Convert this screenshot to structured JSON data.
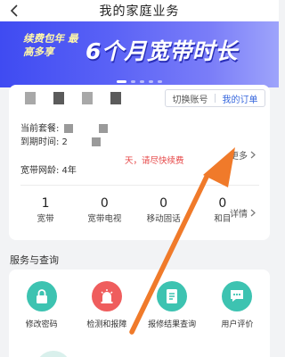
{
  "nav": {
    "back_icon": "chevron-left-icon",
    "title": "我的家庭业务"
  },
  "banner": {
    "slogan": "续费包年 最高多享",
    "headline": "6个月宽带时长"
  },
  "account": {
    "switch_account": "切换账号",
    "my_orders": "我的订单",
    "package_label": "当前套餐:",
    "expiry_label": "到期时间: 2",
    "expiry_warning": "天，请尽快续费",
    "broadband_age": "宽带网龄: 4年",
    "more": "更多"
  },
  "stats": [
    {
      "value": "1",
      "label": "宽带"
    },
    {
      "value": "0",
      "label": "宽带电视"
    },
    {
      "value": "0",
      "label": "移动固话"
    },
    {
      "value": "0",
      "label": "和目"
    }
  ],
  "detail": "详情",
  "services": {
    "title": "服务与查询",
    "items": [
      {
        "label": "修改密码",
        "icon": "lock-icon",
        "color": "#3dc3b1"
      },
      {
        "label": "检测和报障",
        "icon": "alarm-icon",
        "color": "#ef5d5d"
      },
      {
        "label": "报修结果查询",
        "icon": "document-icon",
        "color": "#3dc3b1"
      },
      {
        "label": "用户评价",
        "icon": "chat-bubble-icon",
        "color": "#3dc3b1"
      }
    ]
  },
  "annotation": {
    "arrow_color": "#f07a2a"
  }
}
